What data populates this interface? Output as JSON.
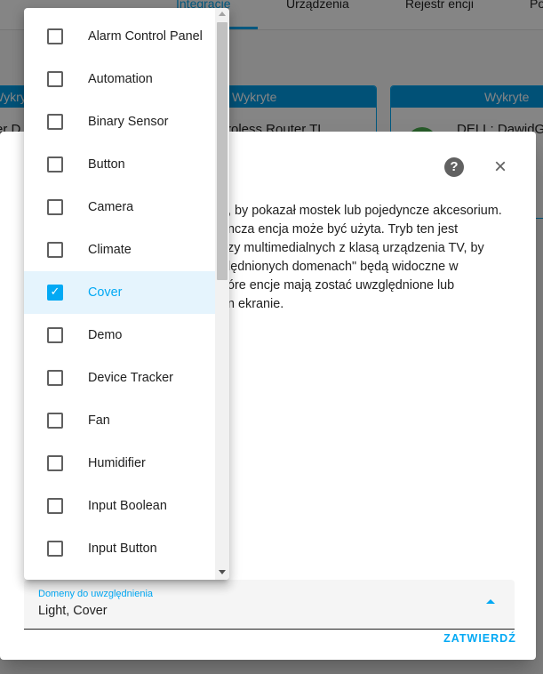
{
  "background": {
    "tabs": [
      {
        "label": "Integracje",
        "active": true
      },
      {
        "label": "Urządzenia",
        "active": false
      },
      {
        "label": "Rejestr encji",
        "active": false
      },
      {
        "label": "Po",
        "active": false
      }
    ],
    "cards": [
      {
        "header": "Wykryte",
        "title": "er D"
      },
      {
        "header": "Wykryte",
        "title": "roless Router TL"
      },
      {
        "header": "Wykryte",
        "title": "DELL: DawidG"
      }
    ]
  },
  "dialog": {
    "description": ", by pokazał mostek lub pojedyncze akcesorium.\nncza encja może być użyta. Tryb ten jest\nzy multimedialnych z klasą urządzenia TV, by\nlędnionych domenach\" będą widoczne w\nóre encje mają zostać uwzględnione lub\nn ekranie.",
    "help_icon": "?",
    "close_icon": "×",
    "domains_field": {
      "label": "Domeny do uwzględnienia",
      "value": "Light, Cover"
    },
    "confirm_label": "ZATWIERDŹ"
  },
  "menu": {
    "items": [
      {
        "label": "Alarm Control Panel",
        "checked": false
      },
      {
        "label": "Automation",
        "checked": false
      },
      {
        "label": "Binary Sensor",
        "checked": false
      },
      {
        "label": "Button",
        "checked": false
      },
      {
        "label": "Camera",
        "checked": false
      },
      {
        "label": "Climate",
        "checked": false
      },
      {
        "label": "Cover",
        "checked": true
      },
      {
        "label": "Demo",
        "checked": false
      },
      {
        "label": "Device Tracker",
        "checked": false
      },
      {
        "label": "Fan",
        "checked": false
      },
      {
        "label": "Humidifier",
        "checked": false
      },
      {
        "label": "Input Boolean",
        "checked": false
      },
      {
        "label": "Input Button",
        "checked": false
      }
    ]
  },
  "colors": {
    "accent": "#03a9f4",
    "card_header": "#039be5",
    "selected_row": "#e5f4fd"
  }
}
